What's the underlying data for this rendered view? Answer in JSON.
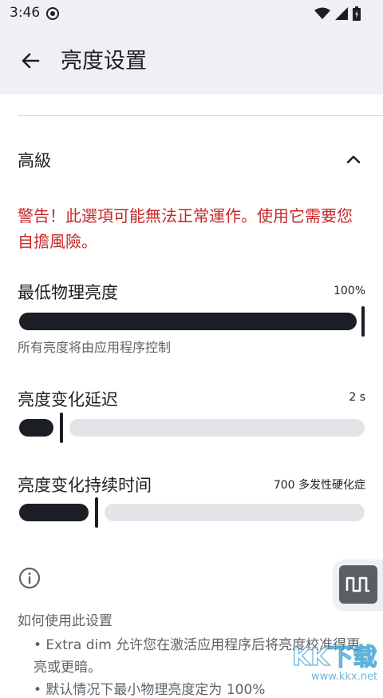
{
  "status_bar": {
    "time": "3:46"
  },
  "app_bar": {
    "title": "亮度设置"
  },
  "section": {
    "label": "高級"
  },
  "warning": "警告！此選項可能無法正常運作。使用它需要您自擔風險。",
  "sliders": [
    {
      "title": "最低物理亮度",
      "value": "100%",
      "subtitle": "所有亮度将由应用程序控制",
      "level": 1.0
    },
    {
      "title": "亮度变化延迟",
      "value": "2 s",
      "level": 0.1
    },
    {
      "title": "亮度变化持续时间",
      "value": "700 多发性硬化症",
      "level": 0.2
    }
  ],
  "help": {
    "title": "如何使用此设置",
    "bullet1": "• Extra dim 允许您在激活应用程序后将亮度校准得更亮或更暗。",
    "bullet2": "• 默认情况下最小物理亮度定为 100%"
  },
  "watermark": {
    "text": "KK下载",
    "url": "www.kkx.net"
  },
  "icons": [
    "brightness-gear-icon",
    "wifi-icon",
    "signal-icon",
    "battery-icon",
    "back-arrow-icon",
    "chevron-up-icon",
    "info-icon",
    "waveform-icon"
  ],
  "colors": {
    "warning": "#c62828",
    "appbar": "#eef0f6",
    "slider_fill": "#1b1e24",
    "slider_track": "#e2e4e8"
  }
}
